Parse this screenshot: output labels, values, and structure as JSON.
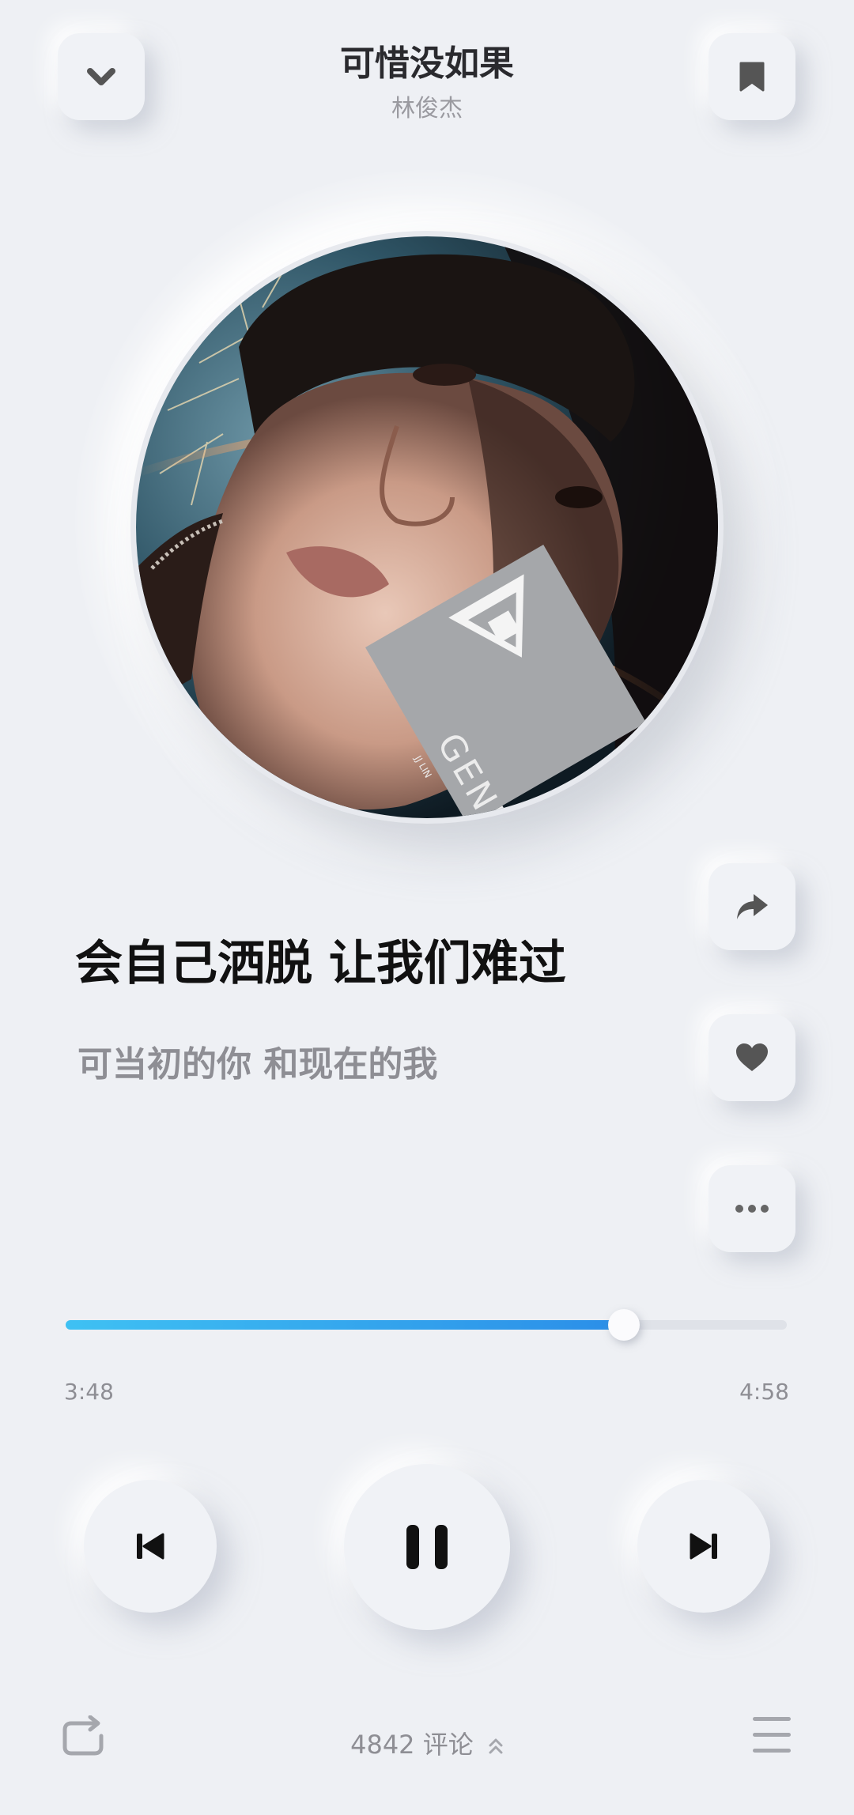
{
  "header": {
    "title": "可惜没如果",
    "artist": "林俊杰",
    "collapse_icon": "chevron-down-icon",
    "bookmark_icon": "bookmark-icon"
  },
  "album_art": {
    "badge_text": "GENESIS",
    "badge_subtext": "JJ LIN"
  },
  "lyrics": {
    "current": "会自己洒脱 让我们难过",
    "next": "可当初的你 和现在的我"
  },
  "side_actions": [
    {
      "icon": "share-icon"
    },
    {
      "icon": "heart-icon"
    },
    {
      "icon": "more-icon"
    }
  ],
  "progress": {
    "fraction": 0.774,
    "elapsed": "3:48",
    "total": "4:58"
  },
  "controls": {
    "prev_icon": "skip-previous-icon",
    "play_icon": "pause-icon",
    "next_icon": "skip-next-icon"
  },
  "footer": {
    "comments": "4842 评论",
    "repeat_icon": "repeat-icon",
    "playlist_icon": "playlist-icon"
  },
  "colors": {
    "background": "#eef0f4",
    "accent_start": "#3fc1f3",
    "accent_end": "#2b8ee8"
  }
}
